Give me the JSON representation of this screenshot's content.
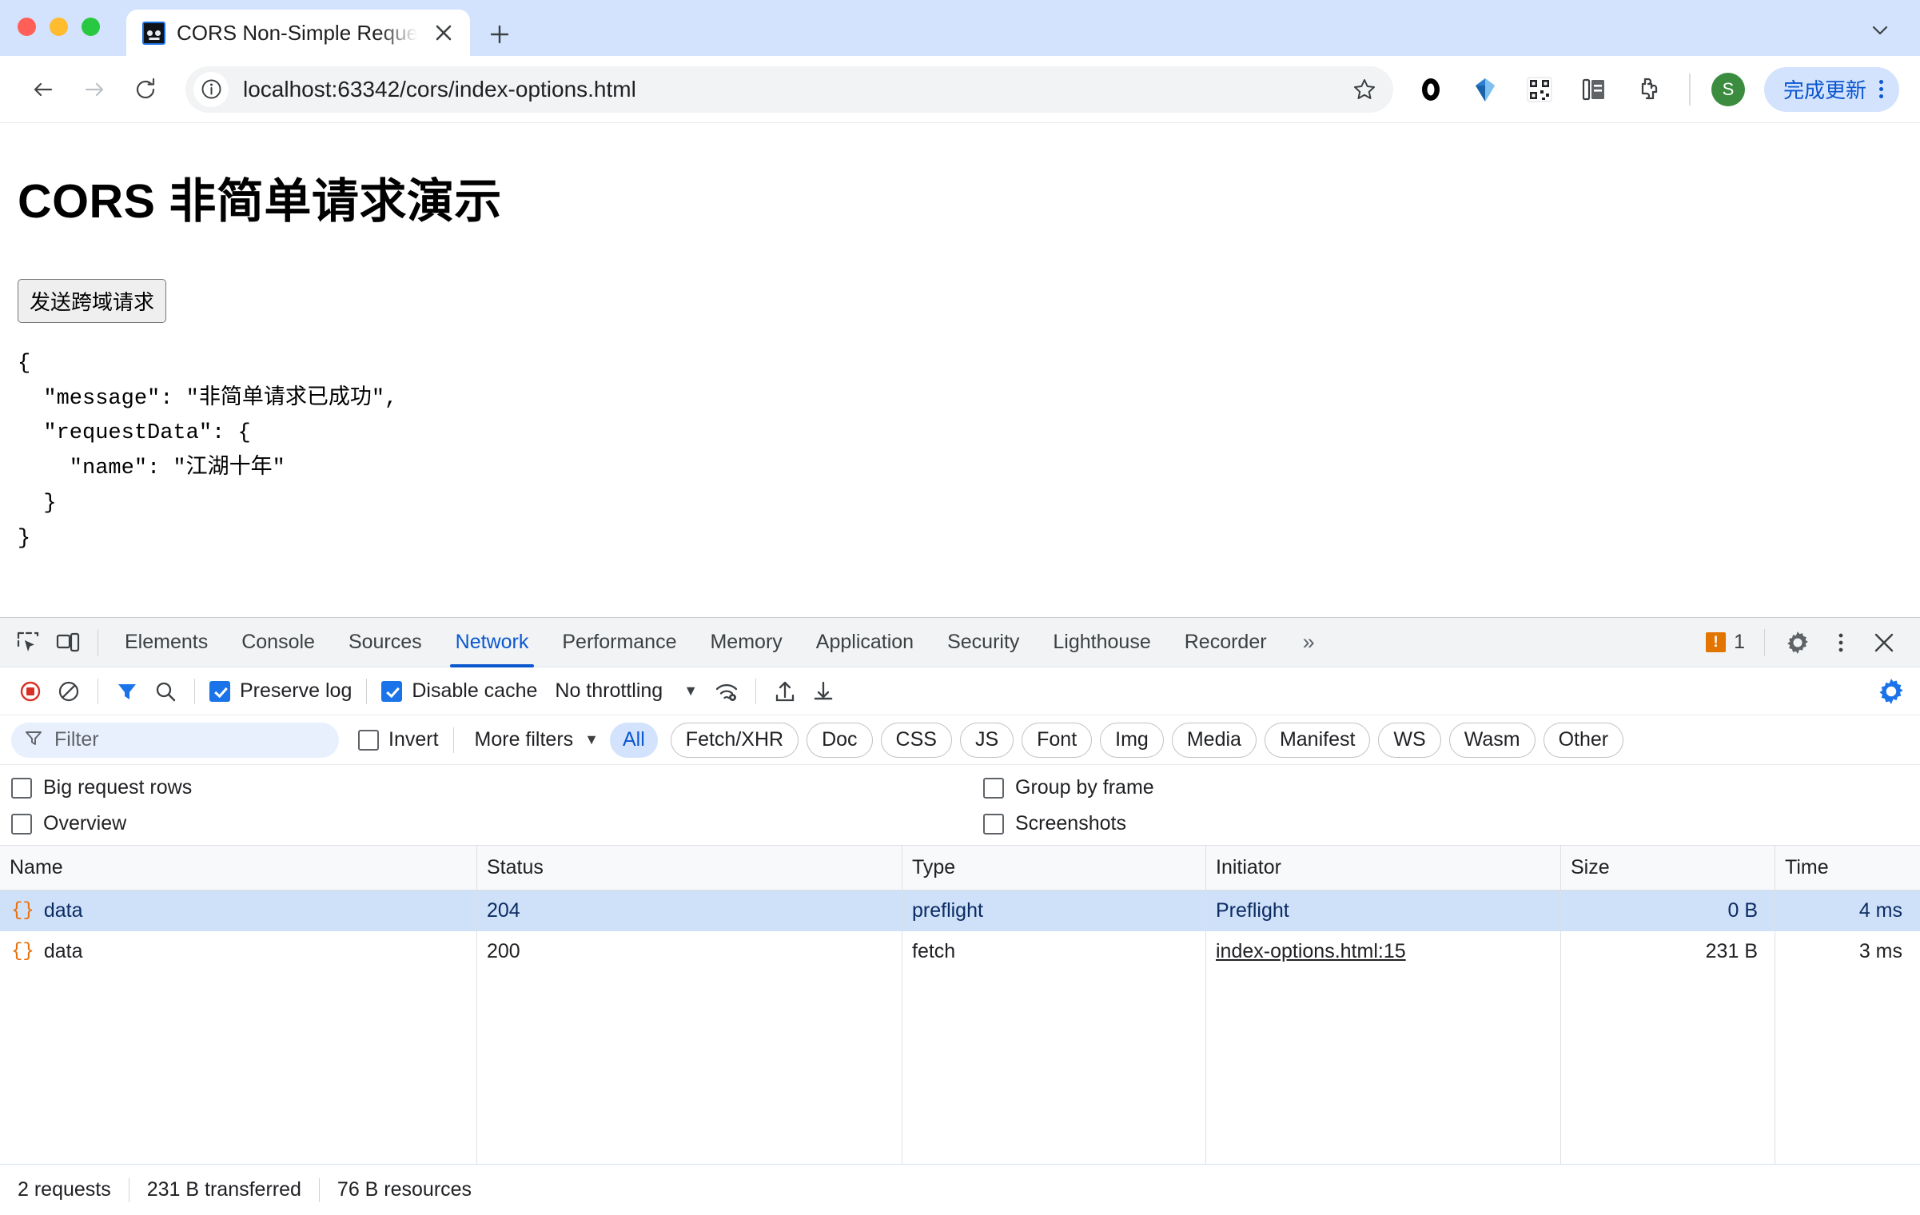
{
  "browser": {
    "tab": {
      "title": "CORS Non-Simple Request D",
      "favicon": "robot-face-icon",
      "close": "×"
    },
    "new_tab": "+",
    "tabstrip_chevron": "⌄",
    "nav": {
      "back": "←",
      "forward": "→",
      "reload": "⟳",
      "url": "localhost:63342/cors/index-options.html",
      "info_icon": "info-circle-icon",
      "star": "☆"
    },
    "extensions": [
      {
        "name": "opera-ring-icon"
      },
      {
        "name": "blue-diamond-pin-icon"
      },
      {
        "name": "qr-code-icon"
      },
      {
        "name": "reading-list-icon"
      },
      {
        "name": "puzzle-extensions-icon"
      }
    ],
    "avatar": "S",
    "update_button": "完成更新",
    "kebab": "⋮"
  },
  "page": {
    "heading": "CORS 非简单请求演示",
    "send_button": "发送跨域请求",
    "output": "{\n  \"message\": \"非简单请求已成功\",\n  \"requestData\": {\n    \"name\": \"江湖十年\"\n  }\n}"
  },
  "devtools": {
    "tabs": [
      {
        "label": "Elements",
        "active": false
      },
      {
        "label": "Console",
        "active": false
      },
      {
        "label": "Sources",
        "active": false
      },
      {
        "label": "Network",
        "active": true
      },
      {
        "label": "Performance",
        "active": false
      },
      {
        "label": "Memory",
        "active": false
      },
      {
        "label": "Application",
        "active": false
      },
      {
        "label": "Security",
        "active": false
      },
      {
        "label": "Lighthouse",
        "active": false
      },
      {
        "label": "Recorder",
        "active": false
      }
    ],
    "more_tabs": "»",
    "warning_count": "1",
    "warning_glyph": "!",
    "settings_icon": "gear-icon",
    "kebab_icon": "more-vertical-icon",
    "close_icon": "close-icon",
    "inspect_icon": "inspect-element-icon",
    "device_icon": "device-toolbar-icon",
    "network_toolbar": {
      "record": "record-stop-icon",
      "clear": "clear-icon",
      "filter": "filter-funnel-icon",
      "search": "search-icon",
      "preserve_log": {
        "label": "Preserve log",
        "checked": true
      },
      "disable_cache": {
        "label": "Disable cache",
        "checked": true
      },
      "throttling": "No throttling",
      "throttling_caret": "▼",
      "network_conditions": "wifi-settings-icon",
      "import_har": "import-har-icon",
      "export_har": "export-har-icon",
      "settings": "network-settings-gear-icon"
    },
    "filter_bar": {
      "filter_placeholder": "Filter",
      "filter_value": "",
      "invert": {
        "label": "Invert",
        "checked": false
      },
      "more_filters": "More filters",
      "more_filters_caret": "▼",
      "types": [
        {
          "label": "All",
          "selected": true
        },
        {
          "label": "Fetch/XHR",
          "selected": false
        },
        {
          "label": "Doc",
          "selected": false
        },
        {
          "label": "CSS",
          "selected": false
        },
        {
          "label": "JS",
          "selected": false
        },
        {
          "label": "Font",
          "selected": false
        },
        {
          "label": "Img",
          "selected": false
        },
        {
          "label": "Media",
          "selected": false
        },
        {
          "label": "Manifest",
          "selected": false
        },
        {
          "label": "WS",
          "selected": false
        },
        {
          "label": "Wasm",
          "selected": false
        },
        {
          "label": "Other",
          "selected": false
        }
      ]
    },
    "options": {
      "big_request_rows": {
        "label": "Big request rows",
        "checked": false
      },
      "overview": {
        "label": "Overview",
        "checked": false
      },
      "group_by_frame": {
        "label": "Group by frame",
        "checked": false
      },
      "screenshots": {
        "label": "Screenshots",
        "checked": false
      }
    },
    "table": {
      "columns": [
        "Name",
        "Status",
        "Type",
        "Initiator",
        "Size",
        "Time"
      ],
      "rows": [
        {
          "icon": "json-braces-icon",
          "name": "data",
          "status": "204",
          "type": "preflight",
          "initiator": "Preflight",
          "initiator_link": false,
          "size": "0 B",
          "time": "4 ms",
          "selected": true
        },
        {
          "icon": "json-braces-icon",
          "name": "data",
          "status": "200",
          "type": "fetch",
          "initiator": "index-options.html:15",
          "initiator_link": true,
          "size": "231 B",
          "time": "3 ms",
          "selected": false
        }
      ]
    },
    "status_bar": {
      "requests": "2 requests",
      "transferred": "231 B transferred",
      "resources": "76 B resources"
    }
  },
  "colors": {
    "chrome_tabstrip": "#d3e3fd",
    "accent_blue": "#0b57d0",
    "selected_row": "#cfe0f9",
    "json_icon_orange": "#e8710a",
    "warning_orange": "#e37400",
    "checkbox_blue": "#1a73e8",
    "avatar_green": "#3c8c40"
  }
}
